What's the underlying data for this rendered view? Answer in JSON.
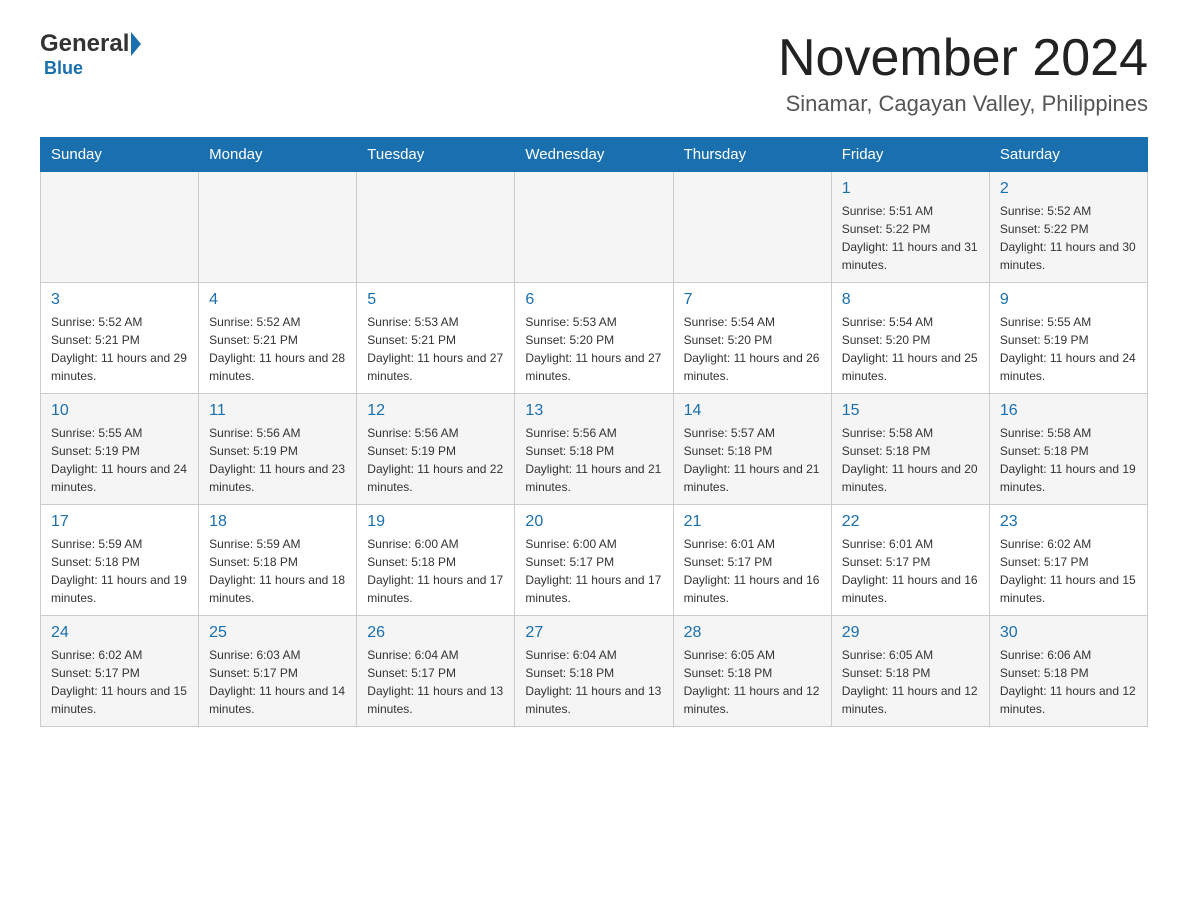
{
  "logo": {
    "text_general": "General",
    "text_blue": "Blue"
  },
  "header": {
    "title": "November 2024",
    "subtitle": "Sinamar, Cagayan Valley, Philippines"
  },
  "days_of_week": [
    "Sunday",
    "Monday",
    "Tuesday",
    "Wednesday",
    "Thursday",
    "Friday",
    "Saturday"
  ],
  "weeks": [
    [
      {
        "day": "",
        "sunrise": "",
        "sunset": "",
        "daylight": ""
      },
      {
        "day": "",
        "sunrise": "",
        "sunset": "",
        "daylight": ""
      },
      {
        "day": "",
        "sunrise": "",
        "sunset": "",
        "daylight": ""
      },
      {
        "day": "",
        "sunrise": "",
        "sunset": "",
        "daylight": ""
      },
      {
        "day": "",
        "sunrise": "",
        "sunset": "",
        "daylight": ""
      },
      {
        "day": "1",
        "sunrise": "Sunrise: 5:51 AM",
        "sunset": "Sunset: 5:22 PM",
        "daylight": "Daylight: 11 hours and 31 minutes."
      },
      {
        "day": "2",
        "sunrise": "Sunrise: 5:52 AM",
        "sunset": "Sunset: 5:22 PM",
        "daylight": "Daylight: 11 hours and 30 minutes."
      }
    ],
    [
      {
        "day": "3",
        "sunrise": "Sunrise: 5:52 AM",
        "sunset": "Sunset: 5:21 PM",
        "daylight": "Daylight: 11 hours and 29 minutes."
      },
      {
        "day": "4",
        "sunrise": "Sunrise: 5:52 AM",
        "sunset": "Sunset: 5:21 PM",
        "daylight": "Daylight: 11 hours and 28 minutes."
      },
      {
        "day": "5",
        "sunrise": "Sunrise: 5:53 AM",
        "sunset": "Sunset: 5:21 PM",
        "daylight": "Daylight: 11 hours and 27 minutes."
      },
      {
        "day": "6",
        "sunrise": "Sunrise: 5:53 AM",
        "sunset": "Sunset: 5:20 PM",
        "daylight": "Daylight: 11 hours and 27 minutes."
      },
      {
        "day": "7",
        "sunrise": "Sunrise: 5:54 AM",
        "sunset": "Sunset: 5:20 PM",
        "daylight": "Daylight: 11 hours and 26 minutes."
      },
      {
        "day": "8",
        "sunrise": "Sunrise: 5:54 AM",
        "sunset": "Sunset: 5:20 PM",
        "daylight": "Daylight: 11 hours and 25 minutes."
      },
      {
        "day": "9",
        "sunrise": "Sunrise: 5:55 AM",
        "sunset": "Sunset: 5:19 PM",
        "daylight": "Daylight: 11 hours and 24 minutes."
      }
    ],
    [
      {
        "day": "10",
        "sunrise": "Sunrise: 5:55 AM",
        "sunset": "Sunset: 5:19 PM",
        "daylight": "Daylight: 11 hours and 24 minutes."
      },
      {
        "day": "11",
        "sunrise": "Sunrise: 5:56 AM",
        "sunset": "Sunset: 5:19 PM",
        "daylight": "Daylight: 11 hours and 23 minutes."
      },
      {
        "day": "12",
        "sunrise": "Sunrise: 5:56 AM",
        "sunset": "Sunset: 5:19 PM",
        "daylight": "Daylight: 11 hours and 22 minutes."
      },
      {
        "day": "13",
        "sunrise": "Sunrise: 5:56 AM",
        "sunset": "Sunset: 5:18 PM",
        "daylight": "Daylight: 11 hours and 21 minutes."
      },
      {
        "day": "14",
        "sunrise": "Sunrise: 5:57 AM",
        "sunset": "Sunset: 5:18 PM",
        "daylight": "Daylight: 11 hours and 21 minutes."
      },
      {
        "day": "15",
        "sunrise": "Sunrise: 5:58 AM",
        "sunset": "Sunset: 5:18 PM",
        "daylight": "Daylight: 11 hours and 20 minutes."
      },
      {
        "day": "16",
        "sunrise": "Sunrise: 5:58 AM",
        "sunset": "Sunset: 5:18 PM",
        "daylight": "Daylight: 11 hours and 19 minutes."
      }
    ],
    [
      {
        "day": "17",
        "sunrise": "Sunrise: 5:59 AM",
        "sunset": "Sunset: 5:18 PM",
        "daylight": "Daylight: 11 hours and 19 minutes."
      },
      {
        "day": "18",
        "sunrise": "Sunrise: 5:59 AM",
        "sunset": "Sunset: 5:18 PM",
        "daylight": "Daylight: 11 hours and 18 minutes."
      },
      {
        "day": "19",
        "sunrise": "Sunrise: 6:00 AM",
        "sunset": "Sunset: 5:18 PM",
        "daylight": "Daylight: 11 hours and 17 minutes."
      },
      {
        "day": "20",
        "sunrise": "Sunrise: 6:00 AM",
        "sunset": "Sunset: 5:17 PM",
        "daylight": "Daylight: 11 hours and 17 minutes."
      },
      {
        "day": "21",
        "sunrise": "Sunrise: 6:01 AM",
        "sunset": "Sunset: 5:17 PM",
        "daylight": "Daylight: 11 hours and 16 minutes."
      },
      {
        "day": "22",
        "sunrise": "Sunrise: 6:01 AM",
        "sunset": "Sunset: 5:17 PM",
        "daylight": "Daylight: 11 hours and 16 minutes."
      },
      {
        "day": "23",
        "sunrise": "Sunrise: 6:02 AM",
        "sunset": "Sunset: 5:17 PM",
        "daylight": "Daylight: 11 hours and 15 minutes."
      }
    ],
    [
      {
        "day": "24",
        "sunrise": "Sunrise: 6:02 AM",
        "sunset": "Sunset: 5:17 PM",
        "daylight": "Daylight: 11 hours and 15 minutes."
      },
      {
        "day": "25",
        "sunrise": "Sunrise: 6:03 AM",
        "sunset": "Sunset: 5:17 PM",
        "daylight": "Daylight: 11 hours and 14 minutes."
      },
      {
        "day": "26",
        "sunrise": "Sunrise: 6:04 AM",
        "sunset": "Sunset: 5:17 PM",
        "daylight": "Daylight: 11 hours and 13 minutes."
      },
      {
        "day": "27",
        "sunrise": "Sunrise: 6:04 AM",
        "sunset": "Sunset: 5:18 PM",
        "daylight": "Daylight: 11 hours and 13 minutes."
      },
      {
        "day": "28",
        "sunrise": "Sunrise: 6:05 AM",
        "sunset": "Sunset: 5:18 PM",
        "daylight": "Daylight: 11 hours and 12 minutes."
      },
      {
        "day": "29",
        "sunrise": "Sunrise: 6:05 AM",
        "sunset": "Sunset: 5:18 PM",
        "daylight": "Daylight: 11 hours and 12 minutes."
      },
      {
        "day": "30",
        "sunrise": "Sunrise: 6:06 AM",
        "sunset": "Sunset: 5:18 PM",
        "daylight": "Daylight: 11 hours and 12 minutes."
      }
    ]
  ]
}
